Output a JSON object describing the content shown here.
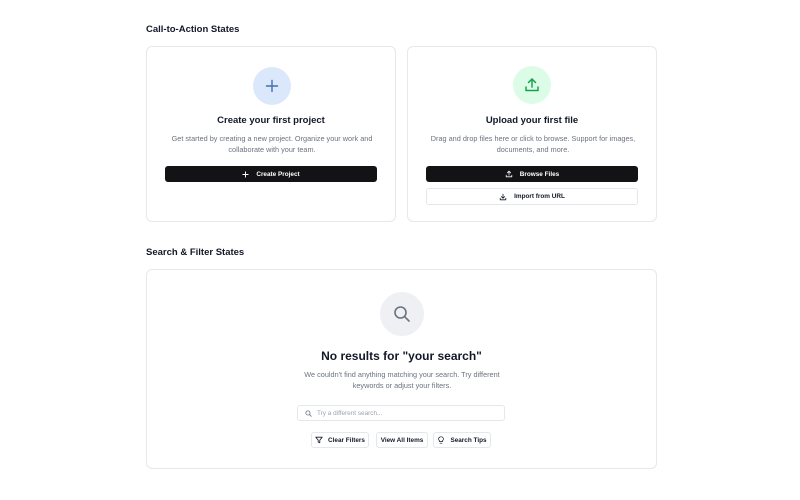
{
  "sections": {
    "cta_title": "Call-to-Action States",
    "search_title": "Search & Filter States"
  },
  "create_card": {
    "icon": "plus-icon",
    "title": "Create your first project",
    "description": "Get started by creating a new project. Organize your work and collaborate with your team.",
    "button_label": "Create Project",
    "colors": {
      "icon_bg": "#dbe8fb",
      "icon_fg": "#3f6fb5"
    }
  },
  "upload_card": {
    "icon": "upload-icon",
    "title": "Upload your first file",
    "description": "Drag and drop files here or click to browse. Support for images, documents, and more.",
    "browse_label": "Browse Files",
    "import_label": "Import from URL",
    "colors": {
      "icon_bg": "#dcfce7",
      "icon_fg": "#16a34a"
    }
  },
  "search_card": {
    "icon": "search-icon",
    "title": "No results for \"your search\"",
    "description": "We couldn't find anything matching your search. Try different keywords or adjust your filters.",
    "search_placeholder": "Try a different search...",
    "actions": {
      "clear_filters": "Clear Filters",
      "view_all": "View All Items",
      "search_tips": "Search Tips"
    },
    "colors": {
      "icon_bg": "#eef0f3",
      "icon_fg": "#6b7280"
    }
  },
  "theme": {
    "primary_button": "#131316",
    "border": "#e8e8ec"
  }
}
